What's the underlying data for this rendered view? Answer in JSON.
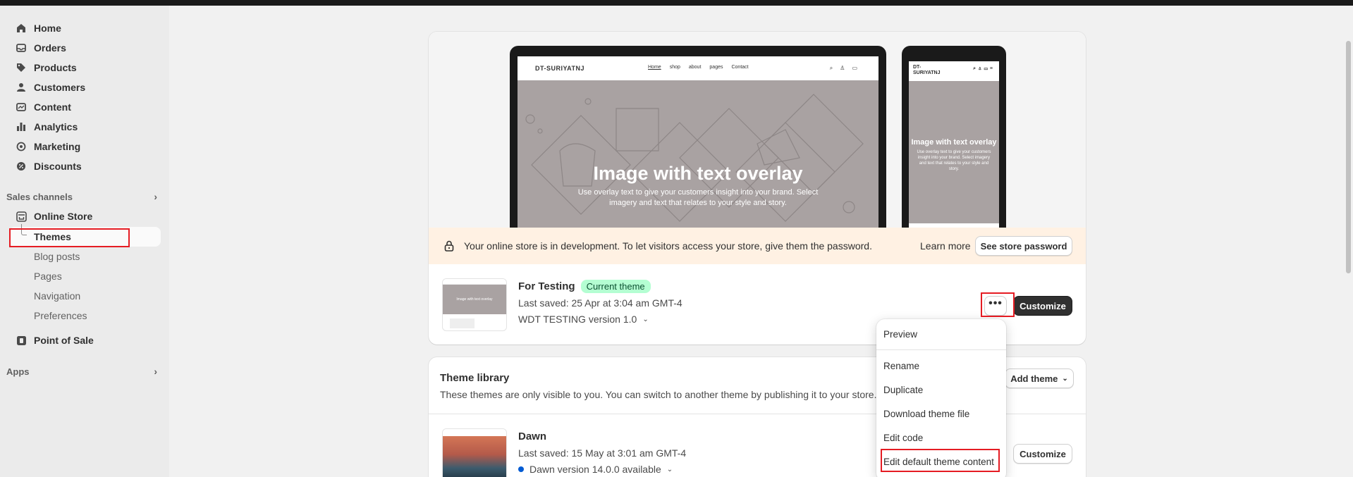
{
  "sidebar": {
    "items": [
      {
        "label": "Home",
        "icon": "home-icon"
      },
      {
        "label": "Orders",
        "icon": "orders-icon"
      },
      {
        "label": "Products",
        "icon": "tag-icon"
      },
      {
        "label": "Customers",
        "icon": "person-icon"
      },
      {
        "label": "Content",
        "icon": "content-icon"
      },
      {
        "label": "Analytics",
        "icon": "bar-chart-icon"
      },
      {
        "label": "Marketing",
        "icon": "target-icon"
      },
      {
        "label": "Discounts",
        "icon": "discount-icon"
      }
    ],
    "sales_channels_label": "Sales channels",
    "online_store_label": "Online Store",
    "online_store_sub": [
      "Themes",
      "Blog posts",
      "Pages",
      "Navigation",
      "Preferences"
    ],
    "pos_label": "Point of Sale",
    "apps_label": "Apps"
  },
  "preview": {
    "store_name": "DT-SURIYATNJ",
    "phone_store_name": "DT-\nSURIYATNJ",
    "nav": [
      "Home",
      "shop",
      "about",
      "pages",
      "Contact"
    ],
    "hero_title": "Image with text overlay",
    "hero_text": "Use overlay text to give your customers insight into your brand. Select imagery and text that relates to your style and story.",
    "phone_hero_title": "Image with text overlay",
    "phone_hero_text": "Use overlay text to give your customers insight into your brand. Select imagery and text that relates to your style and story."
  },
  "banner": {
    "text": "Your online store is in development. To let visitors access your store, give them the password.",
    "learn_more": "Learn more",
    "button": "See store password"
  },
  "current_theme": {
    "name": "For Testing",
    "badge": "Current theme",
    "last_saved": "Last saved: 25 Apr at 3:04 am GMT-4",
    "version": "WDT TESTING version 1.0",
    "thumb_text": "Image with text overlay",
    "customize": "Customize"
  },
  "menu": {
    "items": [
      "Preview",
      "Rename",
      "Duplicate",
      "Download theme file",
      "Edit code",
      "Edit default theme content"
    ]
  },
  "library": {
    "title": "Theme library",
    "description": "These themes are only visible to you. You can switch to another theme by publishing it to your store.",
    "add_theme": "Add theme",
    "theme_name": "Dawn",
    "last_saved": "Last saved: 15 May at 3:01 am GMT-4",
    "version": "Dawn version 14.0.0 available",
    "customize": "Customize"
  },
  "colors": {
    "accent_dark": "#303030",
    "badge_bg": "#b4fed2",
    "banner_bg": "#fff1e3",
    "highlight": "#e51c23"
  }
}
